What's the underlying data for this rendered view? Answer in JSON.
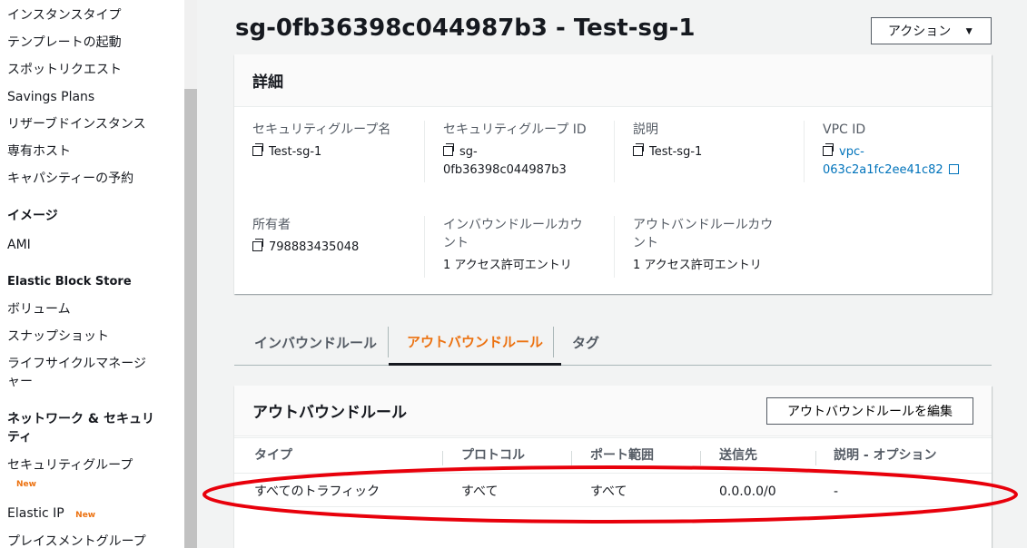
{
  "sidebar": {
    "items": [
      {
        "label": "インスタンスタイプ"
      },
      {
        "label": "テンプレートの起動"
      },
      {
        "label": "スポットリクエスト"
      },
      {
        "label": "Savings Plans"
      },
      {
        "label": "リザーブドインスタンス"
      },
      {
        "label": "専有ホスト"
      },
      {
        "label": "キャパシティーの予約"
      }
    ],
    "images_header": "イメージ",
    "ami": "AMI",
    "ebs_header": "Elastic Block Store",
    "volume": "ボリューム",
    "snapshot": "スナップショット",
    "lifecycle_1": "ライフサイクルマネージ",
    "lifecycle_2": "ャー",
    "network_header_1": "ネットワーク & セキュリ",
    "network_header_2": "ティ",
    "security_groups": "セキュリティグループ",
    "new_badge_1": "New",
    "elastic_ip": "Elastic IP",
    "new_badge_2": "New",
    "placement_groups": "プレイスメントグループ"
  },
  "header": {
    "title": "sg-0fb36398c044987b3 - Test-sg-1",
    "action_label": "アクション",
    "action_caret": "▼"
  },
  "details": {
    "title": "詳細",
    "sg_name_label": "セキュリティグループ名",
    "sg_name_value": "Test-sg-1",
    "sg_id_label": "セキュリティグループ ID",
    "sg_id_value_1": "sg-",
    "sg_id_value_2": "0fb36398c044987b3",
    "desc_label": "説明",
    "desc_value": "Test-sg-1",
    "vpc_label": "VPC ID",
    "vpc_value_1": "vpc-",
    "vpc_value_2": "063c2a1fc2ee41c82",
    "owner_label": "所有者",
    "owner_value": "798883435048",
    "inbound_count_label_1": "インバウンドルールカウ",
    "inbound_count_label_2": "ント",
    "inbound_count_value": "1 アクセス許可エントリ",
    "outbound_count_label_1": "アウトバンドルールカウ",
    "outbound_count_label_2": "ント",
    "outbound_count_value": "1 アクセス許可エントリ"
  },
  "tabs": [
    {
      "label": "インバウンドルール"
    },
    {
      "label": "アウトバウンドルール"
    },
    {
      "label": "タグ"
    }
  ],
  "outbound": {
    "title": "アウトバウンドルール",
    "edit_button": "アウトバウンドルールを編集",
    "columns": [
      "タイプ",
      "プロトコル",
      "ポート範囲",
      "送信先",
      "説明 - オプション"
    ],
    "rows": [
      [
        "すべてのトラフィック",
        "すべて",
        "すべて",
        "0.0.0.0/0",
        "-"
      ]
    ]
  },
  "colors": {
    "accent": "#ec7211",
    "link": "#0073bb",
    "annotation": "#e8000b"
  }
}
